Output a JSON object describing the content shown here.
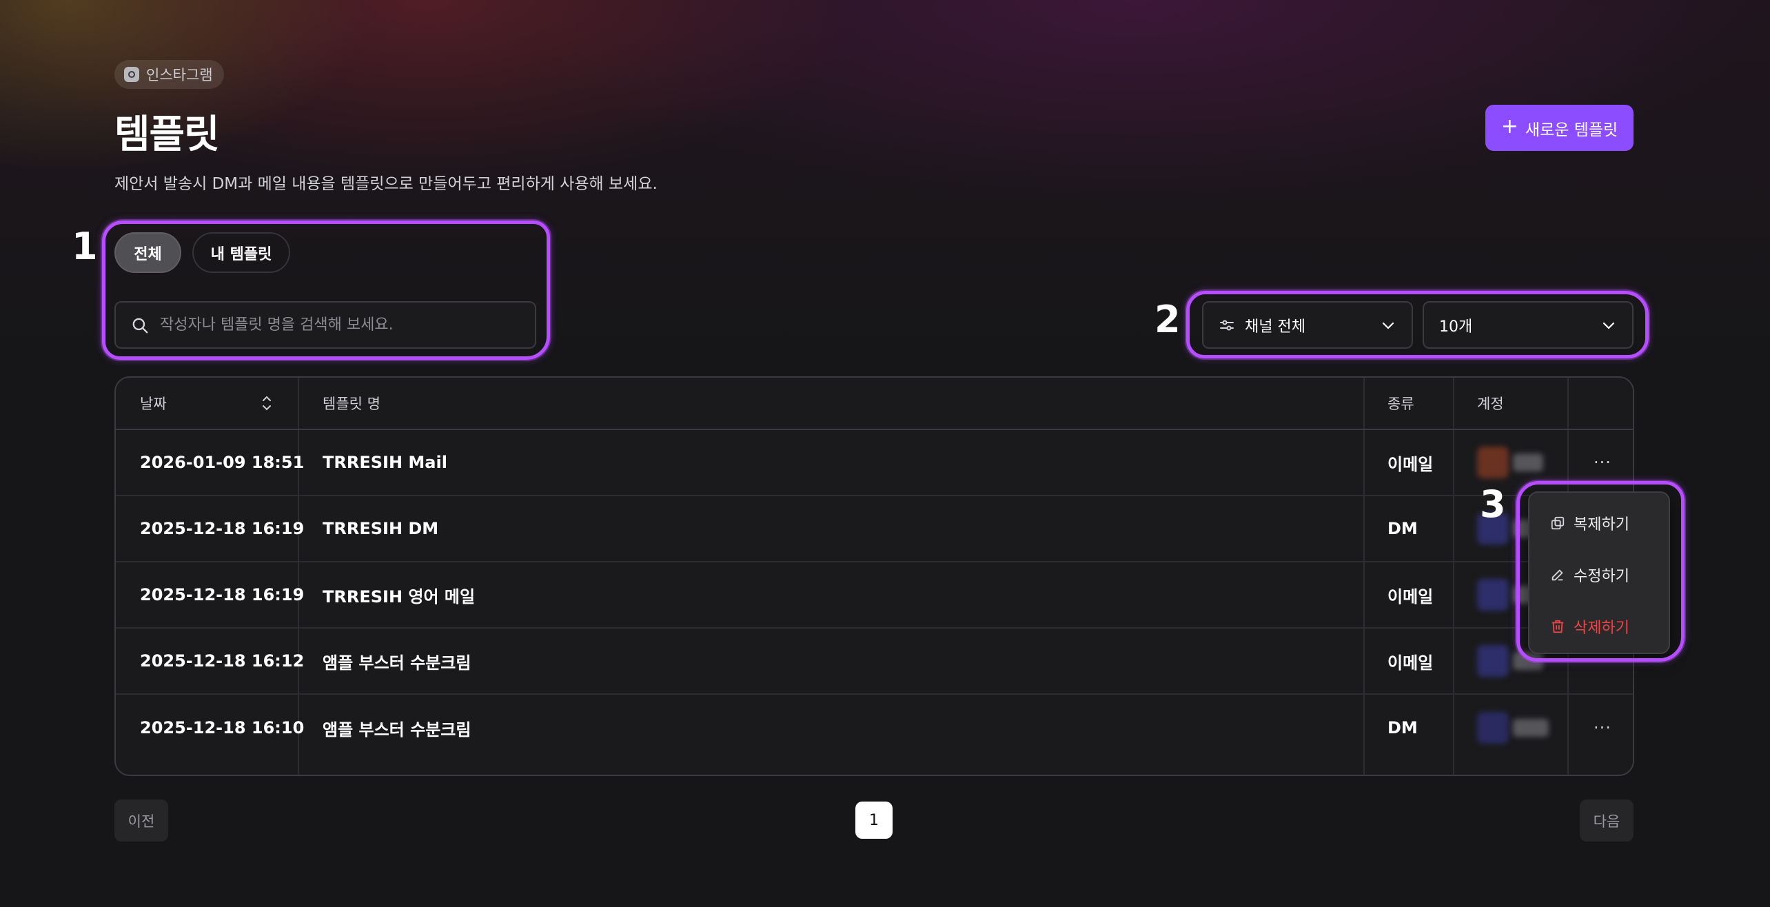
{
  "header": {
    "channel_chip": "인스타그램",
    "title": "템플릿",
    "subtitle": "제안서 발송시 DM과 메일 내용을 템플릿으로 만들어두고 편리하게 사용해 보세요.",
    "new_button": "새로운 템플릿",
    "new_button_icon": "plus-icon"
  },
  "annotations": {
    "one": "1",
    "two": "2",
    "three": "3"
  },
  "tabs": [
    {
      "label": "전체",
      "active": true
    },
    {
      "label": "내 템플릿",
      "active": false
    }
  ],
  "search": {
    "placeholder": "작성자나 템플릿 명을 검색해 보세요.",
    "value": ""
  },
  "filters": {
    "channel": {
      "selected": "채널 전체",
      "icon": "sliders-icon"
    },
    "page_size": {
      "selected": "10개"
    }
  },
  "table": {
    "columns": {
      "date": "날짜",
      "name": "템플릿 명",
      "type": "종류",
      "account": "계정"
    },
    "rows": [
      {
        "date": "2026-01-09 18:51",
        "name": "TRRESIH Mail",
        "type": "이메일",
        "more": "···"
      },
      {
        "date": "2025-12-18 16:19",
        "name": "TRRESIH DM",
        "type": "DM",
        "more": "···"
      },
      {
        "date": "2025-12-18 16:19",
        "name": "TRRESIH 영어 메일",
        "type": "이메일",
        "more": "···"
      },
      {
        "date": "2025-12-18 16:12",
        "name": "앰플 부스터 수분크림",
        "type": "이메일",
        "more": "···"
      },
      {
        "date": "2025-12-18 16:10",
        "name": "앰플 부스터 수분크림",
        "type": "DM",
        "more": "···"
      }
    ]
  },
  "context_menu": {
    "duplicate": "복제하기",
    "edit": "수정하기",
    "delete": "삭제하기"
  },
  "pagination": {
    "prev": "이전",
    "current": "1",
    "next": "다음"
  },
  "colors": {
    "accent": "#8b4dff",
    "annotation": "#b64dff",
    "danger": "#ef4444"
  }
}
